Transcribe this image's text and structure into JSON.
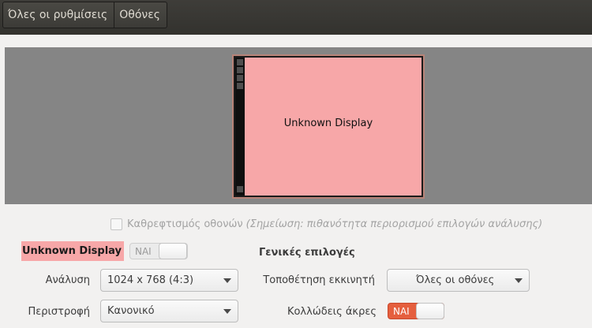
{
  "toolbar": {
    "all_settings": "Όλες οι ρυθμίσεις",
    "displays": "Οθόνες"
  },
  "preview": {
    "monitor_label": "Unknown Display",
    "monitor_color": "#f7a7a8"
  },
  "mirror": {
    "label": "Καθρεφτισμός οθονών",
    "note": "(Σημείωση: πιθανότητα περιορισμού επιλογών ανάλυσης)",
    "checked": false,
    "enabled": false
  },
  "display": {
    "name": "Unknown Display",
    "enabled_toggle": {
      "label": "ΝΑΙ",
      "on": false
    }
  },
  "resolution": {
    "label": "Ανάλυση",
    "value": "1024 x 768 (4:3)"
  },
  "rotation": {
    "label": "Περιστροφή",
    "value": "Κανονικό"
  },
  "general": {
    "heading": "Γενικές επιλογές",
    "launcher_placement": {
      "label": "Τοποθέτηση εκκινητή",
      "value": "Όλες οι οθόνες"
    },
    "sticky_edges": {
      "label": "Κολλώδεις άκρες",
      "toggle_label": "ΝΑΙ",
      "on": true
    }
  },
  "colors": {
    "accent": "#e55f3e",
    "display_highlight": "#f7a7a8",
    "toolbar_bg": "#3c3b37"
  }
}
